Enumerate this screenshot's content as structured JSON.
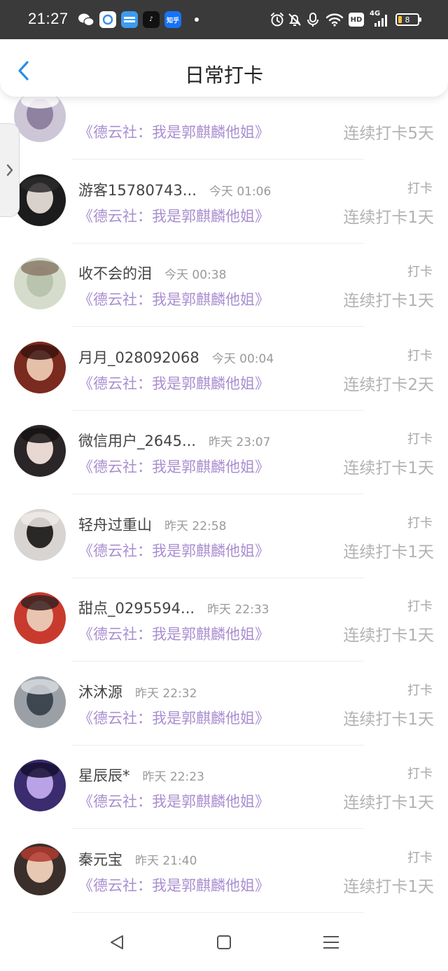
{
  "status_bar": {
    "time": "21:27",
    "app_icons": [
      {
        "name": "wechat-icon",
        "bg": "#3a3a3a",
        "fg": "#ffffff",
        "text": ""
      },
      {
        "name": "app-icon-circle",
        "bg": "#ffffff",
        "fg": "#3a8ee0",
        "text": ""
      },
      {
        "name": "app-icon-blue",
        "bg": "#3d9bf0",
        "fg": "#ffffff",
        "text": ""
      },
      {
        "name": "tiktok-icon",
        "bg": "#111111",
        "fg": "#ffffff",
        "text": "♪"
      },
      {
        "name": "zhihu-icon",
        "bg": "#1772f6",
        "fg": "#ffffff",
        "text": "知乎"
      }
    ],
    "network": "4G",
    "hd": "HD",
    "battery": "8"
  },
  "header": {
    "title": "日常打卡"
  },
  "checkins": [
    {
      "name": "",
      "time": "",
      "book": "《德云社：我是郭麒麟他姐》",
      "tag": "",
      "streak": "连续打卡5天",
      "partial": true,
      "avatar": [
        "#cdc6d6",
        "#8e82a0",
        "#ffffff"
      ]
    },
    {
      "name": "游客15780743...",
      "time": "今天 01:06",
      "book": "《德云社：我是郭麒麟他姐》",
      "tag": "打卡",
      "streak": "连续打卡1天",
      "avatar": [
        "#1c1c1c",
        "#d9d2cc",
        "#2a2a2a"
      ]
    },
    {
      "name": "收不会的泪",
      "time": "今天 00:38",
      "book": "《德云社：我是郭麒麟他姐》",
      "tag": "打卡",
      "streak": "连续打卡1天",
      "avatar": [
        "#d6dccb",
        "#b9c3ad",
        "#8c7a6a"
      ]
    },
    {
      "name": "月月_028092068",
      "time": "今天 00:04",
      "book": "《德云社：我是郭麒麟他姐》",
      "tag": "打卡",
      "streak": "连续打卡2天",
      "avatar": [
        "#7a2a1e",
        "#e6bfa8",
        "#3b1410"
      ]
    },
    {
      "name": "微信用户_2645...",
      "time": "昨天 23:07",
      "book": "《德云社：我是郭麒麟他姐》",
      "tag": "打卡",
      "streak": "连续打卡1天",
      "avatar": [
        "#2a2628",
        "#e8d8d2",
        "#151313"
      ]
    },
    {
      "name": "轻舟过重山",
      "time": "昨天 22:58",
      "book": "《德云社：我是郭麒麟他姐》",
      "tag": "打卡",
      "streak": "连续打卡1天",
      "avatar": [
        "#d8d4d2",
        "#2a2727",
        "#eeeae8"
      ]
    },
    {
      "name": "甜点_0295594...",
      "time": "昨天 22:33",
      "book": "《德云社：我是郭麒麟他姐》",
      "tag": "打卡",
      "streak": "连续打卡1天",
      "avatar": [
        "#c93a2e",
        "#e9c4b0",
        "#3a2222"
      ]
    },
    {
      "name": "沐沐源",
      "time": "昨天 22:32",
      "book": "《德云社：我是郭麒麟他姐》",
      "tag": "打卡",
      "streak": "连续打卡1天",
      "avatar": [
        "#9aa0a6",
        "#3e4650",
        "#d7dadf"
      ]
    },
    {
      "name": "星辰辰*",
      "time": "昨天 22:23",
      "book": "《德云社：我是郭麒麟他姐》",
      "tag": "打卡",
      "streak": "连续打卡1天",
      "avatar": [
        "#3a2c6e",
        "#b9a2e6",
        "#160f30"
      ]
    },
    {
      "name": "秦元宝",
      "time": "昨天 21:40",
      "book": "《德云社：我是郭麒麟他姐》",
      "tag": "打卡",
      "streak": "连续打卡1天",
      "avatar": [
        "#3a2f2a",
        "#e7c8b2",
        "#b13a2f"
      ]
    }
  ],
  "colors": {
    "accent": "#2a8fe6",
    "book_title": "#a98ed0",
    "streak": "#b2b2b2"
  }
}
